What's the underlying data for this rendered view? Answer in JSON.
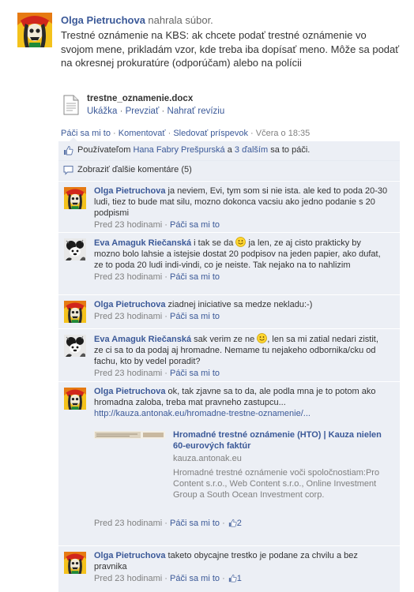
{
  "post": {
    "author": "Olga Pietruchova",
    "action": "nahrala súbor.",
    "text": "Trestné oznámenie na KBS: ak chcete podať trestné oznámenie vo svojom mene, prikladám vzor, kde treba iba dopísať meno. Môže sa podať na okresnej prokuratúre (odporúčam) alebo na polícii",
    "attachment": {
      "filename": "trestne_oznamenie.docx",
      "preview": "Ukážka",
      "download": "Prevziať",
      "upload_revision": "Nahrať revíziu"
    },
    "actions": {
      "like": "Páči sa mi to",
      "comment": "Komentovať",
      "follow": "Sledovať príspevok",
      "time": "Včera o 18:35"
    }
  },
  "likes": {
    "prefix": "Používateľom",
    "name": "Hana Fabry Prešpurská",
    "and": "a",
    "others": "3 ďalším",
    "suffix": "sa to páči."
  },
  "show_more": "Zobraziť ďalšie komentáre (5)",
  "comments": [
    {
      "author": "Olga Pietruchova",
      "text": "ja neviem, Evi, tym som si nie ista. ale ked to poda 20-30 ludi, tiez to bude mat silu, mozno dokonca vacsiu ako jedno podanie s 20 podpismi",
      "time": "Pred 23 hodinami",
      "like": "Páči sa mi to"
    },
    {
      "author": "Eva Amaguk Riečanská",
      "text_a": "i tak se da",
      "text_b": "ja len, ze aj cisto prakticky by mozno bolo lahsie a istejsie dostat 20 podpisov na jeden papier, ako dufat, ze to poda 20 ludi indi-vindi, co je neiste. Tak nejako na to nahlizim",
      "time": "Pred 23 hodinami",
      "like": "Páči sa mi to"
    },
    {
      "author": "Olga Pietruchova",
      "text": "ziadnej iniciative sa medze nekladu:-)",
      "time": "Pred 23 hodinami",
      "like": "Páči sa mi to"
    },
    {
      "author": "Eva Amaguk Riečanská",
      "text_a": "sak verim ze ne",
      "text_b": ", len sa mi zatial nedari zistit, ze ci sa to da podaj aj hromadne. Nemame tu nejakeho odbornika/cku od fachu, kto by vedel poradit?",
      "time": "Pred 23 hodinami",
      "like": "Páči sa mi to"
    },
    {
      "author": "Olga Pietruchova",
      "text": "ok, tak zjavne sa to da, ale podla mna je to potom ako hromadna zaloba, treba mat pravneho zastupcu...",
      "link": "http://kauza.antonak.eu/hromadne-trestne-oznamenie/...",
      "preview": {
        "title": "Hromadné trestné oznámenie (HTO) | Kauza nielen 60-eurových faktúr",
        "domain": "kauza.antonak.eu",
        "description": "Hromadné trestné oznámenie voči spoločnostiam:Pro Content s.r.o., Web Content s.r.o., Online Investment Group a South Ocean Investment corp."
      },
      "time": "Pred 23 hodinami",
      "like": "Páči sa mi to",
      "likes_count": "2"
    },
    {
      "author": "Olga Pietruchova",
      "text": "taketo obycajne trestko je podane za chvilu a bez pravnika",
      "time": "Pred 23 hodinami",
      "like": "Páči sa mi to",
      "likes_count": "1"
    }
  ],
  "separator": "·"
}
